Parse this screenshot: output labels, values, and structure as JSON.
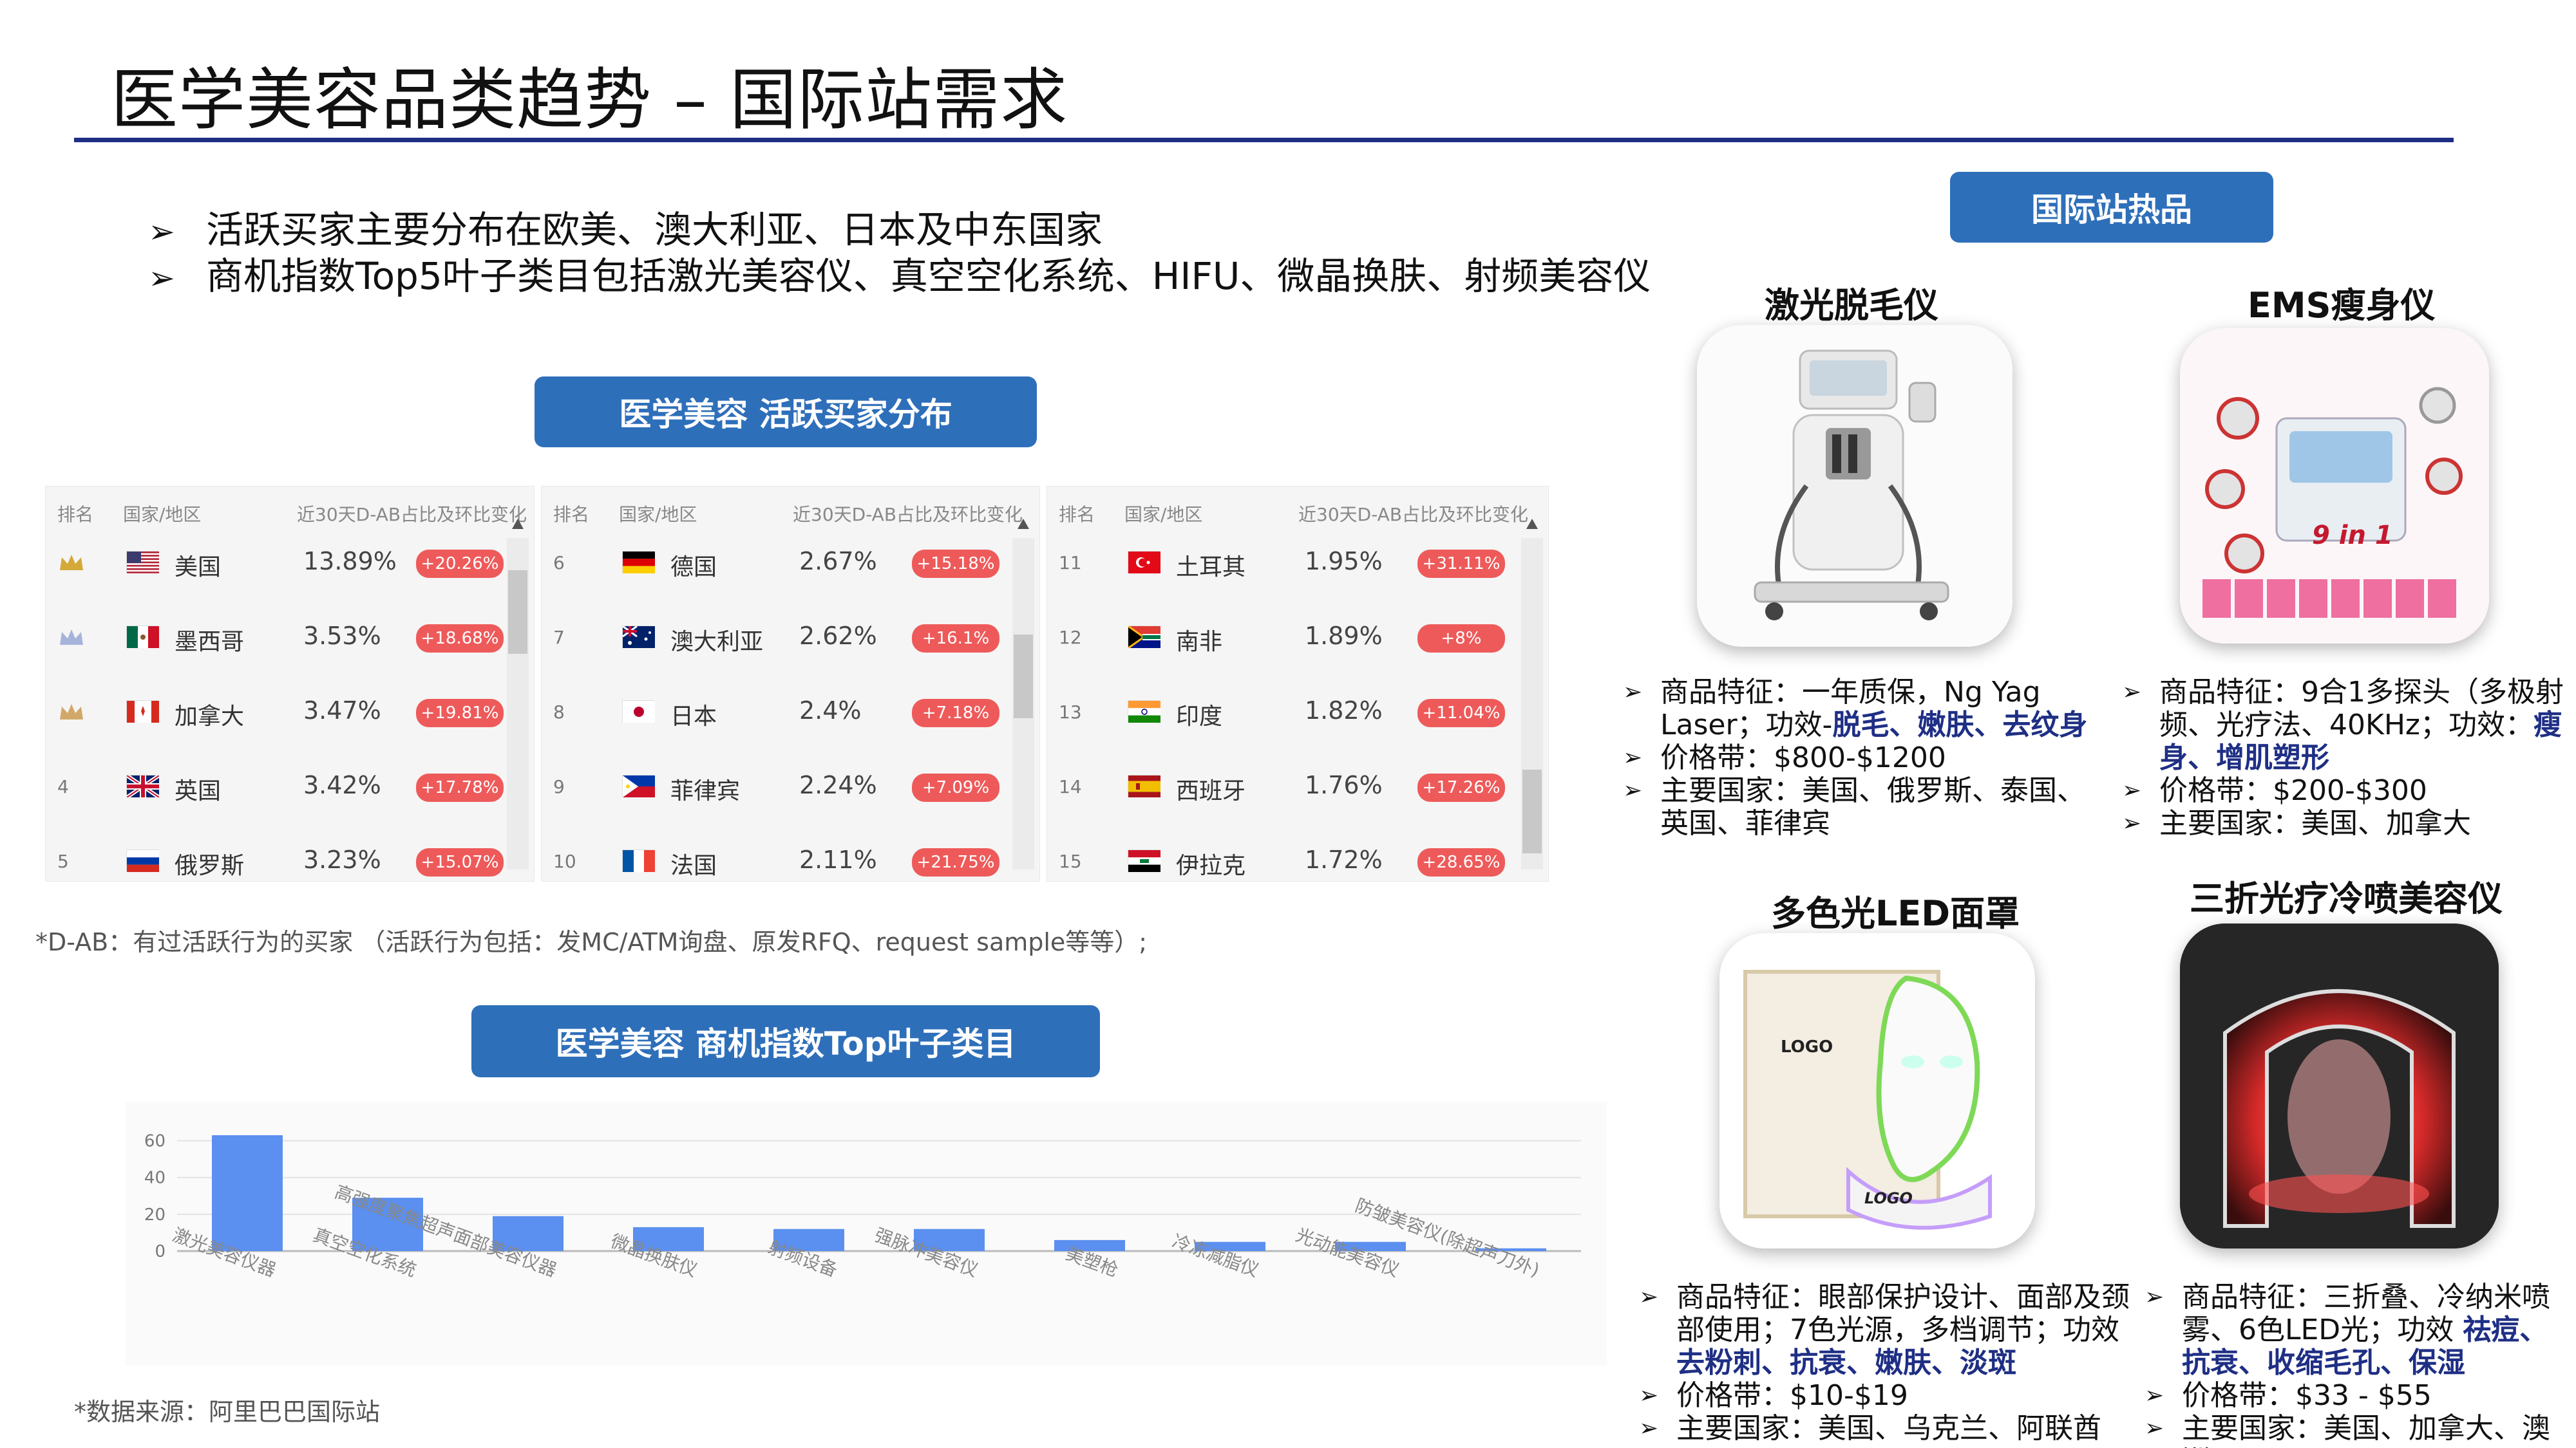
{
  "title": "医学美容品类趋势 – 国际站需求",
  "bullets": [
    "活跃买家主要分布在欧美、澳大利亚、日本及中东国家",
    "商机指数Top5叶子类目包括激光美容仪、真空空化系统、HIFU、微晶换肤、射频美容仪"
  ],
  "section_buyers": "医学美容 活跃买家分布",
  "section_top": "医学美容 商机指数Top叶子类目",
  "section_hot": "国际站热品",
  "table_headers": {
    "rank": "排名",
    "country": "国家/地区",
    "share": "近30天D-AB占比及环比变化"
  },
  "ranking": [
    {
      "rank": "1",
      "country": "美国",
      "share": "13.89%",
      "change": "+20.26%",
      "flag": "us"
    },
    {
      "rank": "2",
      "country": "墨西哥",
      "share": "3.53%",
      "change": "+18.68%",
      "flag": "mx"
    },
    {
      "rank": "3",
      "country": "加拿大",
      "share": "3.47%",
      "change": "+19.81%",
      "flag": "ca"
    },
    {
      "rank": "4",
      "country": "英国",
      "share": "3.42%",
      "change": "+17.78%",
      "flag": "uk"
    },
    {
      "rank": "5",
      "country": "俄罗斯",
      "share": "3.23%",
      "change": "+15.07%",
      "flag": "ru"
    },
    {
      "rank": "6",
      "country": "德国",
      "share": "2.67%",
      "change": "+15.18%",
      "flag": "de"
    },
    {
      "rank": "7",
      "country": "澳大利亚",
      "share": "2.62%",
      "change": "+16.1%",
      "flag": "au"
    },
    {
      "rank": "8",
      "country": "日本",
      "share": "2.4%",
      "change": "+7.18%",
      "flag": "jp"
    },
    {
      "rank": "9",
      "country": "菲律宾",
      "share": "2.24%",
      "change": "+7.09%",
      "flag": "ph"
    },
    {
      "rank": "10",
      "country": "法国",
      "share": "2.11%",
      "change": "+21.75%",
      "flag": "fr"
    },
    {
      "rank": "11",
      "country": "土耳其",
      "share": "1.95%",
      "change": "+31.11%",
      "flag": "tr"
    },
    {
      "rank": "12",
      "country": "南非",
      "share": "1.89%",
      "change": "+8%",
      "flag": "za"
    },
    {
      "rank": "13",
      "country": "印度",
      "share": "1.82%",
      "change": "+11.04%",
      "flag": "in"
    },
    {
      "rank": "14",
      "country": "西班牙",
      "share": "1.76%",
      "change": "+17.26%",
      "flag": "es"
    },
    {
      "rank": "15",
      "country": "伊拉克",
      "share": "1.72%",
      "change": "+28.65%",
      "flag": "iq"
    }
  ],
  "footnote": "*D-AB：有过活跃行为的买家 （活跃行为包括：发MC/ATM询盘、原发RFQ、request sample等等）;",
  "source": "*数据来源：阿里巴巴国际站",
  "colors": {
    "accent": "#2e6fba",
    "bar": "#5b8ff0",
    "highlight": "#1f2f85",
    "badge": "#ee5a5a",
    "rule": "#1f2f85"
  },
  "chart_data": {
    "type": "bar",
    "categories": [
      "激光美容仪器",
      "真空空化系统",
      "高强度聚焦超声面部美容仪器",
      "微晶换肤仪",
      "射频设备",
      "强脉冲美容仪",
      "美塑枪",
      "冷冻减脂仪",
      "光动能美容仪",
      "防皱美容仪(除超声刀外)"
    ],
    "values": [
      63,
      29,
      19,
      13,
      12,
      12,
      6,
      5,
      5,
      1.5
    ],
    "yticks": [
      "0",
      "20",
      "40",
      "60"
    ],
    "ylim": [
      0,
      70
    ]
  },
  "products": [
    {
      "name": "激光脱毛仪",
      "lines": [
        {
          "parts": [
            {
              "t": "商品特征：一年质保，Ng Yag Laser；功效-",
              "h": false
            },
            {
              "t": "脱毛、嫩肤、去纹身",
              "h": true
            }
          ]
        },
        {
          "parts": [
            {
              "t": "价格带：$800-$1200",
              "h": false
            }
          ]
        },
        {
          "parts": [
            {
              "t": "主要国家：美国、俄罗斯、泰国、英国、菲律宾",
              "h": false
            }
          ]
        }
      ]
    },
    {
      "name": "EMS瘦身仪",
      "img_label": "9 in 1",
      "lines": [
        {
          "parts": [
            {
              "t": "商品特征：9合1多探头（多极射频、光疗法、40KHz；功效：",
              "h": false
            },
            {
              "t": "瘦身、增肌塑形",
              "h": true
            }
          ]
        },
        {
          "parts": [
            {
              "t": "价格带：$200-$300",
              "h": false
            }
          ]
        },
        {
          "parts": [
            {
              "t": "主要国家：美国、加拿大",
              "h": false
            }
          ]
        }
      ]
    },
    {
      "name": "多色光LED面罩",
      "img_logo": "LOGO",
      "lines": [
        {
          "parts": [
            {
              "t": "商品特征：眼部保护设计、面部及颈部使用；7色光源，多档调节；功效 ",
              "h": false
            },
            {
              "t": "去粉刺、抗衰、嫩肤、淡斑",
              "h": true
            }
          ]
        },
        {
          "parts": [
            {
              "t": "价格带：$10-$19",
              "h": false
            }
          ]
        },
        {
          "parts": [
            {
              "t": "主要国家：美国、乌克兰、阿联酋",
              "h": false
            }
          ]
        }
      ]
    },
    {
      "name": "三折光疗冷喷美容仪",
      "lines": [
        {
          "parts": [
            {
              "t": "商品特征：三折叠、冷纳米喷雾、6色LED光；功效 ",
              "h": false
            },
            {
              "t": "祛痘、抗衰、收缩毛孔、保湿",
              "h": true
            }
          ]
        },
        {
          "parts": [
            {
              "t": "价格带：$33 - $55",
              "h": false
            }
          ]
        },
        {
          "parts": [
            {
              "t": "主要国家：美国、加拿大、澳洲",
              "h": false
            }
          ]
        }
      ]
    }
  ]
}
